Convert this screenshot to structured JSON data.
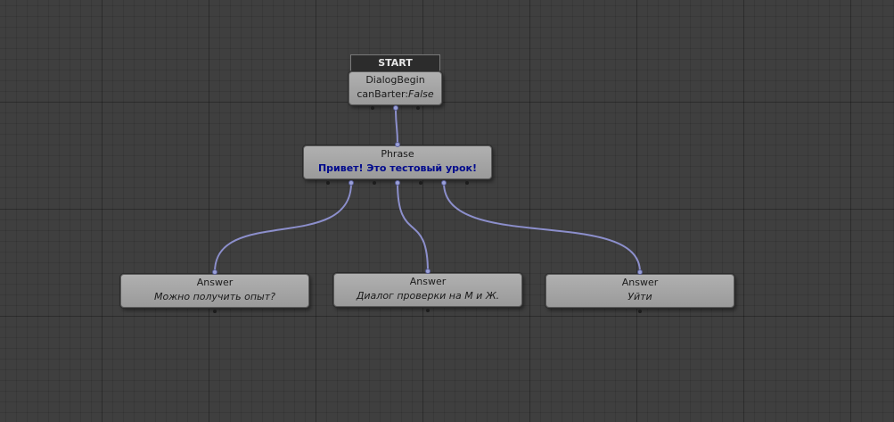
{
  "start": {
    "label": "START"
  },
  "dialog_begin": {
    "title": "DialogBegin",
    "param_label": "canBarter:",
    "param_value": "False"
  },
  "phrase": {
    "title": "Phrase",
    "text": "Привет! Это тестовый урок!"
  },
  "answers": [
    {
      "title": "Answer",
      "text": "Можно получить опыт?"
    },
    {
      "title": "Answer",
      "text": "Диалог проверки на М и Ж."
    },
    {
      "title": "Answer",
      "text": "Уйти"
    }
  ],
  "colors": {
    "canvas_bg": "#3f3f3f",
    "node_bg": "#a5a5a5",
    "connection": "#8c8fcc",
    "phrase_text": "#000a8c"
  }
}
